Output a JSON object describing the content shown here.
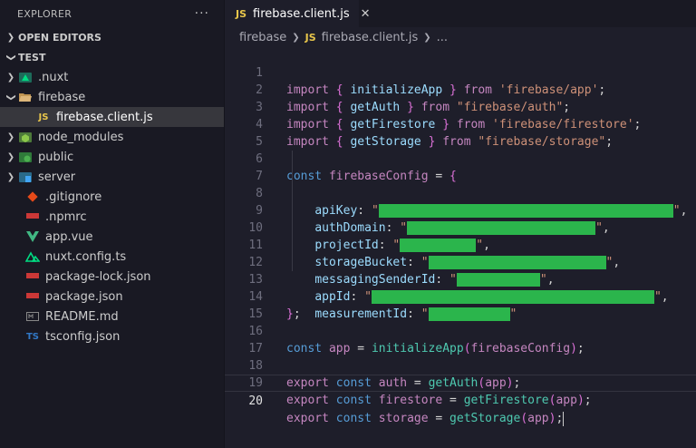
{
  "explorer": {
    "title": "EXPLORER",
    "more": "···",
    "open_editors": "OPEN EDITORS",
    "workspace": "TEST",
    "items": [
      {
        "label": ".nuxt"
      },
      {
        "label": "firebase"
      },
      {
        "label": "firebase.client.js"
      },
      {
        "label": "node_modules"
      },
      {
        "label": "public"
      },
      {
        "label": "server"
      },
      {
        "label": ".gitignore"
      },
      {
        "label": ".npmrc"
      },
      {
        "label": "app.vue"
      },
      {
        "label": "nuxt.config.ts"
      },
      {
        "label": "package-lock.json"
      },
      {
        "label": "package.json"
      },
      {
        "label": "README.md"
      },
      {
        "label": "tsconfig.json"
      }
    ]
  },
  "tab": {
    "icon_text": "JS",
    "label": "firebase.client.js",
    "close": "✕"
  },
  "breadcrumb": {
    "folder": "firebase",
    "icon_text": "JS",
    "file": "firebase.client.js",
    "more": "..."
  },
  "code": {
    "line_numbers": [
      "1",
      "2",
      "3",
      "4",
      "5",
      "6",
      "7",
      "8",
      "9",
      "10",
      "11",
      "12",
      "13",
      "14",
      "15",
      "16",
      "17",
      "18",
      "19",
      "20"
    ],
    "l1": {
      "kw": "import",
      "b1": "{",
      "name": "initializeApp",
      "b2": "}",
      "from": "from",
      "str": "'firebase/app'",
      "end": ";"
    },
    "l2": {
      "kw": "import",
      "b1": "{",
      "name": "getAuth",
      "b2": "}",
      "from": "from",
      "str": "\"firebase/auth\"",
      "end": ";"
    },
    "l3": {
      "kw": "import",
      "b1": "{",
      "name": "getFirestore",
      "b2": "}",
      "from": "from",
      "str": "'firebase/firestore'",
      "end": ";"
    },
    "l4": {
      "kw": "import",
      "b1": "{",
      "name": "getStorage",
      "b2": "}",
      "from": "from",
      "str": "\"firebase/storage\"",
      "end": ";"
    },
    "l6": {
      "kw": "const",
      "name": "firebaseConfig",
      "op": "=",
      "b": "{"
    },
    "config_keys": [
      "apiKey",
      "authDomain",
      "projectId",
      "storageBucket",
      "messagingSenderId",
      "appId",
      "measurementId"
    ],
    "l14": {
      "b": "}",
      "end": ";"
    },
    "l16": {
      "kw": "const",
      "name": "app",
      "op": "=",
      "fn": "initializeApp",
      "open": "(",
      "arg": "firebaseConfig",
      "close": ")",
      "end": ";"
    },
    "l18": {
      "exp": "export",
      "kw": "const",
      "name": "auth",
      "op": "=",
      "fn": "getAuth",
      "open": "(",
      "arg": "app",
      "close": ")",
      "end": ";"
    },
    "l19": {
      "exp": "export",
      "kw": "const",
      "name": "firestore",
      "op": "=",
      "fn": "getFirestore",
      "open": "(",
      "arg": "app",
      "close": ")",
      "end": ";"
    },
    "l20": {
      "exp": "export",
      "kw": "const",
      "name": "storage",
      "op": "=",
      "fn": "getStorage",
      "open": "(",
      "arg": "app",
      "close": ")",
      "end": ";"
    }
  },
  "colors": {
    "redaction": "#2bb54c",
    "js_icon": "#e8c64b"
  }
}
